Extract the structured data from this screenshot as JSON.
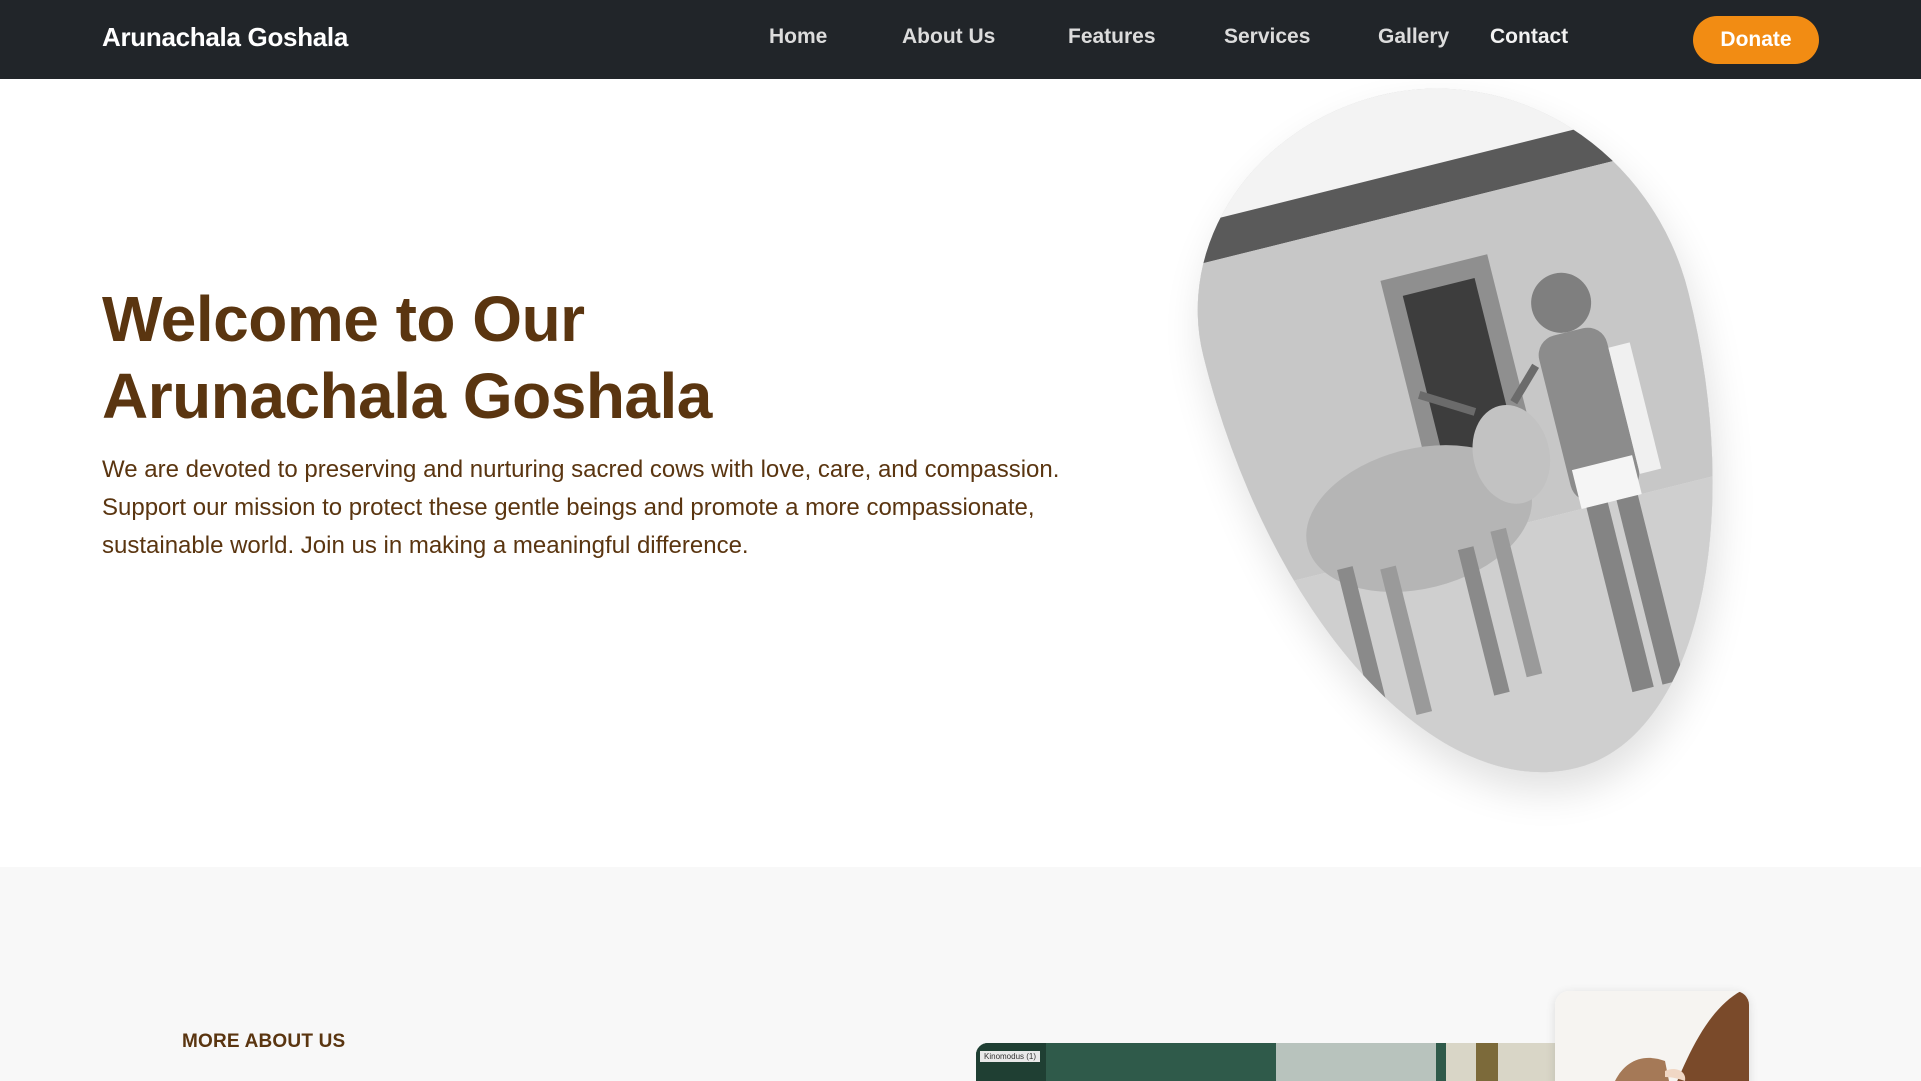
{
  "nav": {
    "brand": "Arunachala Goshala",
    "links": [
      "Home",
      "About Us",
      "Features",
      "Services",
      "Gallery",
      "Contact"
    ],
    "donate_label": "Donate"
  },
  "hero": {
    "title_line1": "Welcome to Our",
    "title_line2": "Arunachala Goshala",
    "description": "We are devoted to preserving and nurturing sacred cows with love, care, and compassion. Support our mission to protect these gentle beings and promote a more compassionate, sustainable world. Join us in making a meaningful difference."
  },
  "about": {
    "kicker": "MORE ABOUT US",
    "image_tag": "Kinomodus (1)"
  },
  "colors": {
    "navbar": "#212529",
    "accent": "#f28c13",
    "heading": "#5a3510",
    "section_bg": "#f8f8f8"
  }
}
